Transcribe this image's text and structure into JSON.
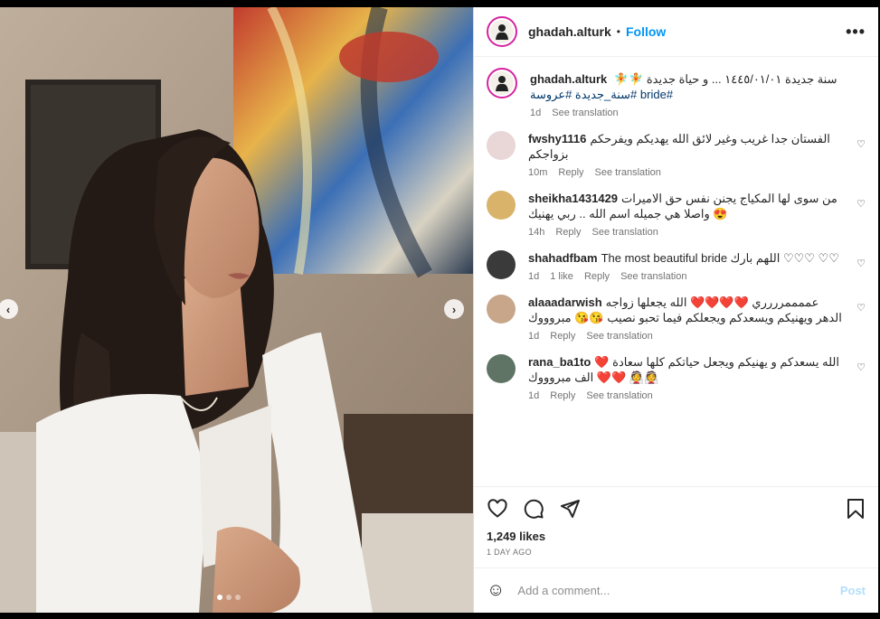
{
  "header": {
    "username": "ghadah.alturk",
    "separator": "•",
    "follow_label": "Follow",
    "more_label": "•••"
  },
  "caption": {
    "username": "ghadah.alturk",
    "text": "سنة جديدة ١٤٤٥/٠١/٠١ ... و حياة جديدة",
    "emoji": "🧚🧚",
    "hashtags": "#bride #سنة_جديدة #عروسة",
    "time": "1d",
    "see_translation": "See translation"
  },
  "comments": [
    {
      "user": "fwshy1116",
      "text": "الفستان جدا غريب وغير لائق الله يهديكم ويفرحكم بزواجكم",
      "time": "10m",
      "likes": "",
      "reply": "Reply",
      "see_translation": "See translation",
      "avatar_color": "#e9d6d6"
    },
    {
      "user": "sheikha1431429",
      "text": "من سوى لها المكياج يجنن نفس حق الاميرات 😍 واصلا هي جميله اسم الله .. ربي يهنيك",
      "time": "14h",
      "likes": "",
      "reply": "Reply",
      "see_translation": "See translation",
      "avatar_color": "#d9b36a"
    },
    {
      "user": "shahadfbam",
      "text": "The most beautiful bride اللهم بارك ♡♡♡ ♡♡",
      "time": "1d",
      "likes": "1 like",
      "reply": "Reply",
      "see_translation": "See translation",
      "avatar_color": "#3a3a3a"
    },
    {
      "user": "alaaadarwish",
      "text": "عممممرررري ❤️❤️❤️❤️ الله يجعلها زواجه الدهر ويهنيكم ويسعدكم ويجعلكم فيما تحبو نصيب 😘😘 مبروووك",
      "time": "1d",
      "likes": "",
      "reply": "Reply",
      "see_translation": "See translation",
      "avatar_color": "#c7a68a"
    },
    {
      "user": "rana_ba1to",
      "text": "الله يسعدكم و يهنيكم ويجعل حياتكم كلها سعادة ❤️ ❤️❤️ الف مبروووك 👰👰",
      "time": "1d",
      "likes": "",
      "reply": "Reply",
      "see_translation": "See translation",
      "avatar_color": "#5f7464"
    }
  ],
  "likes_text": "1,249 likes",
  "date_text": "1 DAY AGO",
  "add_comment": {
    "placeholder": "Add a comment...",
    "post_label": "Post"
  },
  "colors": {
    "accent": "#0095f6",
    "heart_red": "#ed4956",
    "story_ring": "#d6249f"
  }
}
